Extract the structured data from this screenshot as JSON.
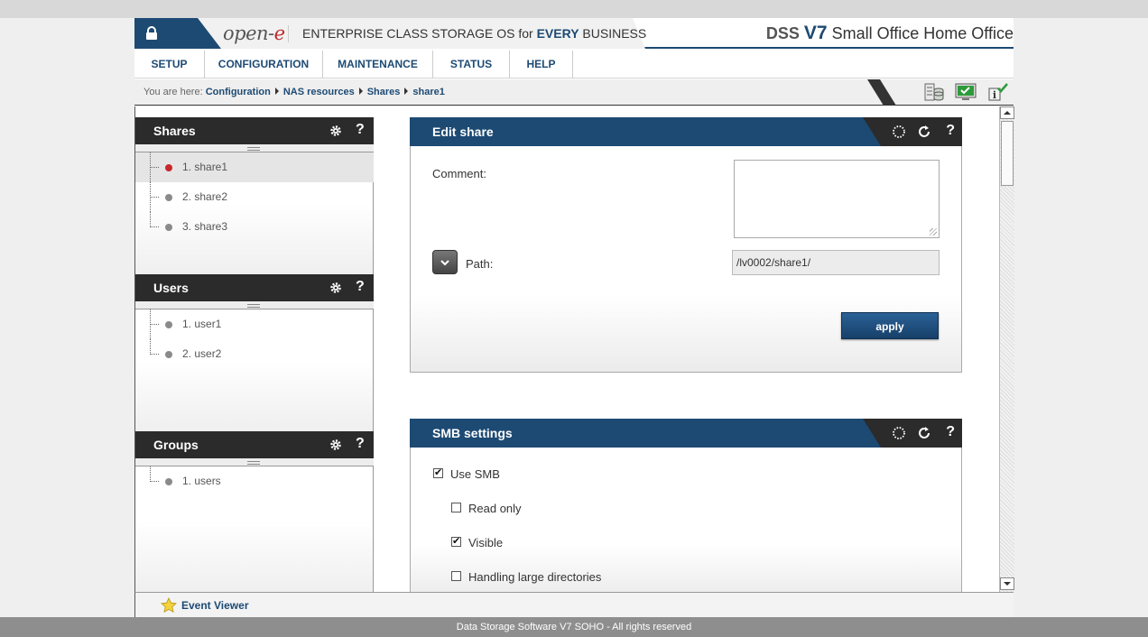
{
  "header": {
    "logo_prefix": "open-",
    "logo_suffix": "e",
    "tagline_pre": "ENTERPRISE CLASS STORAGE OS for ",
    "tagline_bold": "EVERY",
    "tagline_post": " BUSINESS",
    "product_dss": "DSS",
    "product_version": "V7",
    "product_edition": "Small Office Home Office",
    "accent_color": "#1d4a73"
  },
  "menu": {
    "items": [
      "SETUP",
      "CONFIGURATION",
      "MAINTENANCE",
      "STATUS",
      "HELP"
    ]
  },
  "breadcrumb": {
    "prefix": "You are here:",
    "items": [
      "Configuration",
      "NAS resources",
      "Shares",
      "share1"
    ]
  },
  "toolbar_icons": [
    "storage-db-icon",
    "monitor-icon",
    "info-check-icon"
  ],
  "left": {
    "shares": {
      "title": "Shares",
      "items": [
        "1. share1",
        "2. share2",
        "3. share3"
      ],
      "selected": "1. share1"
    },
    "users": {
      "title": "Users",
      "items": [
        "1. user1",
        "2. user2"
      ]
    },
    "groups": {
      "title": "Groups",
      "items": [
        "1. users"
      ]
    },
    "help_glyph": "?"
  },
  "edit_share": {
    "title": "Edit share",
    "comment_label": "Comment:",
    "comment_value": "",
    "path_label": "Path:",
    "path_value": "/lv0002/share1/",
    "apply_label": "apply"
  },
  "smb": {
    "title": "SMB settings",
    "options": [
      {
        "label": "Use SMB",
        "checked": true
      },
      {
        "label": "Read only",
        "checked": false
      },
      {
        "label": "Visible",
        "checked": true
      },
      {
        "label": "Handling large directories",
        "checked": false
      }
    ]
  },
  "event_viewer": {
    "label": "Event Viewer"
  },
  "footer": {
    "text": "Data Storage Software V7 SOHO - All rights reserved"
  }
}
